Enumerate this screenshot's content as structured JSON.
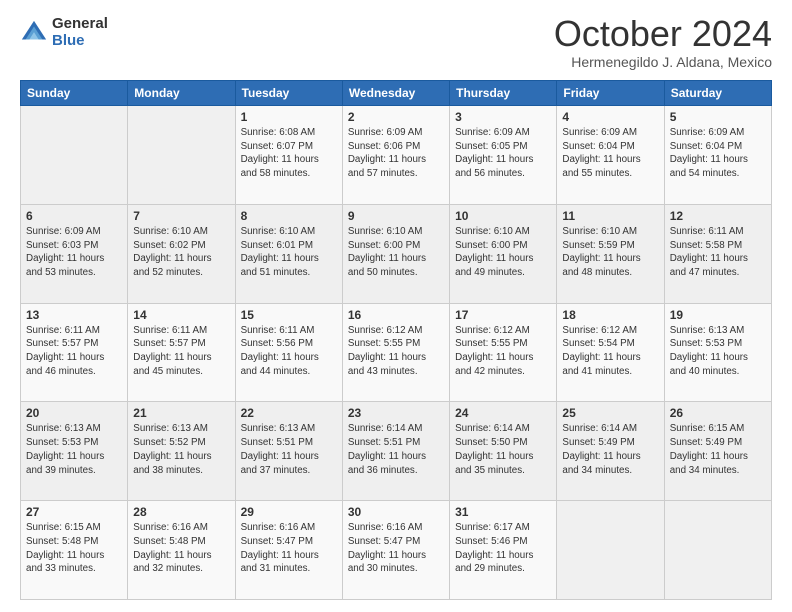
{
  "logo": {
    "general": "General",
    "blue": "Blue"
  },
  "title": "October 2024",
  "subtitle": "Hermenegildo J. Aldana, Mexico",
  "days_of_week": [
    "Sunday",
    "Monday",
    "Tuesday",
    "Wednesday",
    "Thursday",
    "Friday",
    "Saturday"
  ],
  "weeks": [
    [
      {
        "day": "",
        "sunrise": "",
        "sunset": "",
        "daylight": ""
      },
      {
        "day": "",
        "sunrise": "",
        "sunset": "",
        "daylight": ""
      },
      {
        "day": "1",
        "sunrise": "Sunrise: 6:08 AM",
        "sunset": "Sunset: 6:07 PM",
        "daylight": "Daylight: 11 hours and 58 minutes."
      },
      {
        "day": "2",
        "sunrise": "Sunrise: 6:09 AM",
        "sunset": "Sunset: 6:06 PM",
        "daylight": "Daylight: 11 hours and 57 minutes."
      },
      {
        "day": "3",
        "sunrise": "Sunrise: 6:09 AM",
        "sunset": "Sunset: 6:05 PM",
        "daylight": "Daylight: 11 hours and 56 minutes."
      },
      {
        "day": "4",
        "sunrise": "Sunrise: 6:09 AM",
        "sunset": "Sunset: 6:04 PM",
        "daylight": "Daylight: 11 hours and 55 minutes."
      },
      {
        "day": "5",
        "sunrise": "Sunrise: 6:09 AM",
        "sunset": "Sunset: 6:04 PM",
        "daylight": "Daylight: 11 hours and 54 minutes."
      }
    ],
    [
      {
        "day": "6",
        "sunrise": "Sunrise: 6:09 AM",
        "sunset": "Sunset: 6:03 PM",
        "daylight": "Daylight: 11 hours and 53 minutes."
      },
      {
        "day": "7",
        "sunrise": "Sunrise: 6:10 AM",
        "sunset": "Sunset: 6:02 PM",
        "daylight": "Daylight: 11 hours and 52 minutes."
      },
      {
        "day": "8",
        "sunrise": "Sunrise: 6:10 AM",
        "sunset": "Sunset: 6:01 PM",
        "daylight": "Daylight: 11 hours and 51 minutes."
      },
      {
        "day": "9",
        "sunrise": "Sunrise: 6:10 AM",
        "sunset": "Sunset: 6:00 PM",
        "daylight": "Daylight: 11 hours and 50 minutes."
      },
      {
        "day": "10",
        "sunrise": "Sunrise: 6:10 AM",
        "sunset": "Sunset: 6:00 PM",
        "daylight": "Daylight: 11 hours and 49 minutes."
      },
      {
        "day": "11",
        "sunrise": "Sunrise: 6:10 AM",
        "sunset": "Sunset: 5:59 PM",
        "daylight": "Daylight: 11 hours and 48 minutes."
      },
      {
        "day": "12",
        "sunrise": "Sunrise: 6:11 AM",
        "sunset": "Sunset: 5:58 PM",
        "daylight": "Daylight: 11 hours and 47 minutes."
      }
    ],
    [
      {
        "day": "13",
        "sunrise": "Sunrise: 6:11 AM",
        "sunset": "Sunset: 5:57 PM",
        "daylight": "Daylight: 11 hours and 46 minutes."
      },
      {
        "day": "14",
        "sunrise": "Sunrise: 6:11 AM",
        "sunset": "Sunset: 5:57 PM",
        "daylight": "Daylight: 11 hours and 45 minutes."
      },
      {
        "day": "15",
        "sunrise": "Sunrise: 6:11 AM",
        "sunset": "Sunset: 5:56 PM",
        "daylight": "Daylight: 11 hours and 44 minutes."
      },
      {
        "day": "16",
        "sunrise": "Sunrise: 6:12 AM",
        "sunset": "Sunset: 5:55 PM",
        "daylight": "Daylight: 11 hours and 43 minutes."
      },
      {
        "day": "17",
        "sunrise": "Sunrise: 6:12 AM",
        "sunset": "Sunset: 5:55 PM",
        "daylight": "Daylight: 11 hours and 42 minutes."
      },
      {
        "day": "18",
        "sunrise": "Sunrise: 6:12 AM",
        "sunset": "Sunset: 5:54 PM",
        "daylight": "Daylight: 11 hours and 41 minutes."
      },
      {
        "day": "19",
        "sunrise": "Sunrise: 6:13 AM",
        "sunset": "Sunset: 5:53 PM",
        "daylight": "Daylight: 11 hours and 40 minutes."
      }
    ],
    [
      {
        "day": "20",
        "sunrise": "Sunrise: 6:13 AM",
        "sunset": "Sunset: 5:53 PM",
        "daylight": "Daylight: 11 hours and 39 minutes."
      },
      {
        "day": "21",
        "sunrise": "Sunrise: 6:13 AM",
        "sunset": "Sunset: 5:52 PM",
        "daylight": "Daylight: 11 hours and 38 minutes."
      },
      {
        "day": "22",
        "sunrise": "Sunrise: 6:13 AM",
        "sunset": "Sunset: 5:51 PM",
        "daylight": "Daylight: 11 hours and 37 minutes."
      },
      {
        "day": "23",
        "sunrise": "Sunrise: 6:14 AM",
        "sunset": "Sunset: 5:51 PM",
        "daylight": "Daylight: 11 hours and 36 minutes."
      },
      {
        "day": "24",
        "sunrise": "Sunrise: 6:14 AM",
        "sunset": "Sunset: 5:50 PM",
        "daylight": "Daylight: 11 hours and 35 minutes."
      },
      {
        "day": "25",
        "sunrise": "Sunrise: 6:14 AM",
        "sunset": "Sunset: 5:49 PM",
        "daylight": "Daylight: 11 hours and 34 minutes."
      },
      {
        "day": "26",
        "sunrise": "Sunrise: 6:15 AM",
        "sunset": "Sunset: 5:49 PM",
        "daylight": "Daylight: 11 hours and 34 minutes."
      }
    ],
    [
      {
        "day": "27",
        "sunrise": "Sunrise: 6:15 AM",
        "sunset": "Sunset: 5:48 PM",
        "daylight": "Daylight: 11 hours and 33 minutes."
      },
      {
        "day": "28",
        "sunrise": "Sunrise: 6:16 AM",
        "sunset": "Sunset: 5:48 PM",
        "daylight": "Daylight: 11 hours and 32 minutes."
      },
      {
        "day": "29",
        "sunrise": "Sunrise: 6:16 AM",
        "sunset": "Sunset: 5:47 PM",
        "daylight": "Daylight: 11 hours and 31 minutes."
      },
      {
        "day": "30",
        "sunrise": "Sunrise: 6:16 AM",
        "sunset": "Sunset: 5:47 PM",
        "daylight": "Daylight: 11 hours and 30 minutes."
      },
      {
        "day": "31",
        "sunrise": "Sunrise: 6:17 AM",
        "sunset": "Sunset: 5:46 PM",
        "daylight": "Daylight: 11 hours and 29 minutes."
      },
      {
        "day": "",
        "sunrise": "",
        "sunset": "",
        "daylight": ""
      },
      {
        "day": "",
        "sunrise": "",
        "sunset": "",
        "daylight": ""
      }
    ]
  ]
}
